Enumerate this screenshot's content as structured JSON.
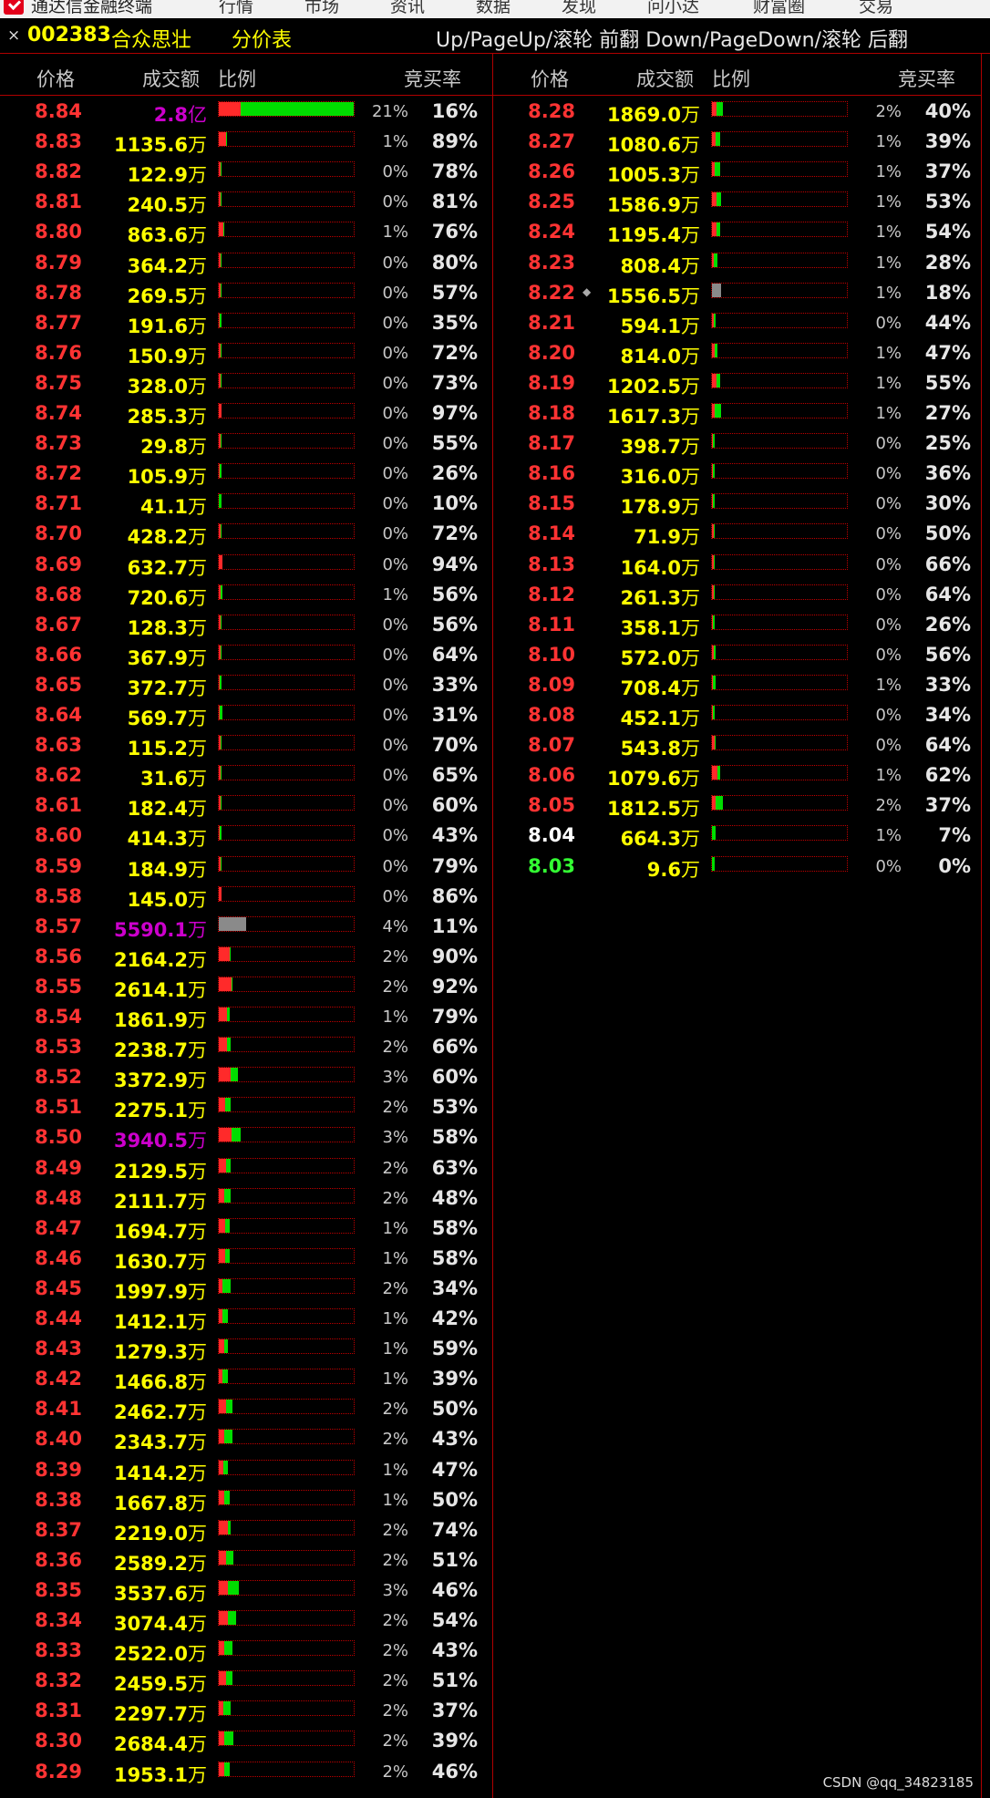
{
  "menubar": {
    "app_title": "通达信金融终端",
    "items": [
      "行情",
      "市场",
      "资讯",
      "数据",
      "发现",
      "问小达",
      "财富圈",
      "交易"
    ]
  },
  "titlebar": {
    "close_symbol": "×",
    "stock_code": "002383",
    "stock_name": "合众思壮",
    "table_name": "分价表",
    "hint": "Up/PageUp/滚轮 前翻 Down/PageDown/滚轮 后翻"
  },
  "headers": {
    "price": "价格",
    "volume": "成交额",
    "ratio": "比例",
    "bid_rate": "竞买率"
  },
  "colors": {
    "up": "#ff3333",
    "flat": "#ffffff",
    "down": "#33ff33",
    "volume_normal": "#ffff00",
    "volume_large": "#cc00cc",
    "bar_buy": "#ff2a2a",
    "bar_sell": "#00dd00",
    "divider": "#b00000"
  },
  "left_rows": [
    {
      "price": "8.84",
      "amount": "2.8",
      "unit": "亿",
      "pct": "21%",
      "rate": "16%",
      "big": true,
      "share": 1.0,
      "buy": 0.16
    },
    {
      "price": "8.83",
      "amount": "1135.6",
      "unit": "万",
      "pct": "1%",
      "rate": "89%",
      "share": 0.06,
      "buy": 0.89
    },
    {
      "price": "8.82",
      "amount": "122.9",
      "unit": "万",
      "pct": "0%",
      "rate": "78%",
      "share": 0.01,
      "buy": 0.78
    },
    {
      "price": "8.81",
      "amount": "240.5",
      "unit": "万",
      "pct": "0%",
      "rate": "81%",
      "share": 0.01,
      "buy": 0.81
    },
    {
      "price": "8.80",
      "amount": "863.6",
      "unit": "万",
      "pct": "1%",
      "rate": "76%",
      "share": 0.04,
      "buy": 0.76
    },
    {
      "price": "8.79",
      "amount": "364.2",
      "unit": "万",
      "pct": "0%",
      "rate": "80%",
      "share": 0.01,
      "buy": 0.8
    },
    {
      "price": "8.78",
      "amount": "269.5",
      "unit": "万",
      "pct": "0%",
      "rate": "57%",
      "share": 0.01,
      "buy": 0.57
    },
    {
      "price": "8.77",
      "amount": "191.6",
      "unit": "万",
      "pct": "0%",
      "rate": "35%",
      "share": 0.01,
      "buy": 0.35
    },
    {
      "price": "8.76",
      "amount": "150.9",
      "unit": "万",
      "pct": "0%",
      "rate": "72%",
      "share": 0.01,
      "buy": 0.72
    },
    {
      "price": "8.75",
      "amount": "328.0",
      "unit": "万",
      "pct": "0%",
      "rate": "73%",
      "share": 0.01,
      "buy": 0.73
    },
    {
      "price": "8.74",
      "amount": "285.3",
      "unit": "万",
      "pct": "0%",
      "rate": "97%",
      "share": 0.01,
      "buy": 0.97
    },
    {
      "price": "8.73",
      "amount": "29.8",
      "unit": "万",
      "pct": "0%",
      "rate": "55%",
      "share": 0.01,
      "buy": 0.55
    },
    {
      "price": "8.72",
      "amount": "105.9",
      "unit": "万",
      "pct": "0%",
      "rate": "26%",
      "share": 0.01,
      "buy": 0.26
    },
    {
      "price": "8.71",
      "amount": "41.1",
      "unit": "万",
      "pct": "0%",
      "rate": "10%",
      "share": 0.01,
      "buy": 0.1
    },
    {
      "price": "8.70",
      "amount": "428.2",
      "unit": "万",
      "pct": "0%",
      "rate": "72%",
      "share": 0.01,
      "buy": 0.72
    },
    {
      "price": "8.69",
      "amount": "632.7",
      "unit": "万",
      "pct": "0%",
      "rate": "94%",
      "share": 0.03,
      "buy": 0.94
    },
    {
      "price": "8.68",
      "amount": "720.6",
      "unit": "万",
      "pct": "1%",
      "rate": "56%",
      "share": 0.03,
      "buy": 0.56
    },
    {
      "price": "8.67",
      "amount": "128.3",
      "unit": "万",
      "pct": "0%",
      "rate": "56%",
      "share": 0.01,
      "buy": 0.56
    },
    {
      "price": "8.66",
      "amount": "367.9",
      "unit": "万",
      "pct": "0%",
      "rate": "64%",
      "share": 0.01,
      "buy": 0.64
    },
    {
      "price": "8.65",
      "amount": "372.7",
      "unit": "万",
      "pct": "0%",
      "rate": "33%",
      "share": 0.01,
      "buy": 0.33
    },
    {
      "price": "8.64",
      "amount": "569.7",
      "unit": "万",
      "pct": "0%",
      "rate": "31%",
      "share": 0.03,
      "buy": 0.31
    },
    {
      "price": "8.63",
      "amount": "115.2",
      "unit": "万",
      "pct": "0%",
      "rate": "70%",
      "share": 0.01,
      "buy": 0.7
    },
    {
      "price": "8.62",
      "amount": "31.6",
      "unit": "万",
      "pct": "0%",
      "rate": "65%",
      "share": 0.01,
      "buy": 0.65
    },
    {
      "price": "8.61",
      "amount": "182.4",
      "unit": "万",
      "pct": "0%",
      "rate": "60%",
      "share": 0.01,
      "buy": 0.6
    },
    {
      "price": "8.60",
      "amount": "414.3",
      "unit": "万",
      "pct": "0%",
      "rate": "43%",
      "share": 0.01,
      "buy": 0.43
    },
    {
      "price": "8.59",
      "amount": "184.9",
      "unit": "万",
      "pct": "0%",
      "rate": "79%",
      "share": 0.01,
      "buy": 0.79
    },
    {
      "price": "8.58",
      "amount": "145.0",
      "unit": "万",
      "pct": "0%",
      "rate": "86%",
      "share": 0.01,
      "buy": 0.86
    },
    {
      "price": "8.57",
      "amount": "5590.1",
      "unit": "万",
      "pct": "4%",
      "rate": "11%",
      "big": true,
      "gray": true,
      "share": 0.2,
      "buy": 0.11
    },
    {
      "price": "8.56",
      "amount": "2164.2",
      "unit": "万",
      "pct": "2%",
      "rate": "90%",
      "share": 0.09,
      "buy": 0.9
    },
    {
      "price": "8.55",
      "amount": "2614.1",
      "unit": "万",
      "pct": "2%",
      "rate": "92%",
      "share": 0.1,
      "buy": 0.92
    },
    {
      "price": "8.54",
      "amount": "1861.9",
      "unit": "万",
      "pct": "1%",
      "rate": "79%",
      "share": 0.08,
      "buy": 0.79
    },
    {
      "price": "8.53",
      "amount": "2238.7",
      "unit": "万",
      "pct": "2%",
      "rate": "66%",
      "share": 0.09,
      "buy": 0.66
    },
    {
      "price": "8.52",
      "amount": "3372.9",
      "unit": "万",
      "pct": "3%",
      "rate": "60%",
      "share": 0.14,
      "buy": 0.6
    },
    {
      "price": "8.51",
      "amount": "2275.1",
      "unit": "万",
      "pct": "2%",
      "rate": "53%",
      "share": 0.09,
      "buy": 0.53
    },
    {
      "price": "8.50",
      "amount": "3940.5",
      "unit": "万",
      "pct": "3%",
      "rate": "58%",
      "big": true,
      "share": 0.16,
      "buy": 0.58
    },
    {
      "price": "8.49",
      "amount": "2129.5",
      "unit": "万",
      "pct": "2%",
      "rate": "63%",
      "share": 0.09,
      "buy": 0.63
    },
    {
      "price": "8.48",
      "amount": "2111.7",
      "unit": "万",
      "pct": "2%",
      "rate": "48%",
      "share": 0.09,
      "buy": 0.48
    },
    {
      "price": "8.47",
      "amount": "1694.7",
      "unit": "万",
      "pct": "1%",
      "rate": "58%",
      "share": 0.08,
      "buy": 0.58
    },
    {
      "price": "8.46",
      "amount": "1630.7",
      "unit": "万",
      "pct": "1%",
      "rate": "58%",
      "share": 0.08,
      "buy": 0.58
    },
    {
      "price": "8.45",
      "amount": "1997.9",
      "unit": "万",
      "pct": "2%",
      "rate": "34%",
      "share": 0.09,
      "buy": 0.34
    },
    {
      "price": "8.44",
      "amount": "1412.1",
      "unit": "万",
      "pct": "1%",
      "rate": "42%",
      "share": 0.07,
      "buy": 0.42
    },
    {
      "price": "8.43",
      "amount": "1279.3",
      "unit": "万",
      "pct": "1%",
      "rate": "59%",
      "share": 0.07,
      "buy": 0.59
    },
    {
      "price": "8.42",
      "amount": "1466.8",
      "unit": "万",
      "pct": "1%",
      "rate": "39%",
      "share": 0.07,
      "buy": 0.39
    },
    {
      "price": "8.41",
      "amount": "2462.7",
      "unit": "万",
      "pct": "2%",
      "rate": "50%",
      "share": 0.1,
      "buy": 0.5
    },
    {
      "price": "8.40",
      "amount": "2343.7",
      "unit": "万",
      "pct": "2%",
      "rate": "43%",
      "share": 0.1,
      "buy": 0.43
    },
    {
      "price": "8.39",
      "amount": "1414.2",
      "unit": "万",
      "pct": "1%",
      "rate": "47%",
      "share": 0.07,
      "buy": 0.47
    },
    {
      "price": "8.38",
      "amount": "1667.8",
      "unit": "万",
      "pct": "1%",
      "rate": "50%",
      "share": 0.08,
      "buy": 0.5
    },
    {
      "price": "8.37",
      "amount": "2219.0",
      "unit": "万",
      "pct": "2%",
      "rate": "74%",
      "share": 0.09,
      "buy": 0.74
    },
    {
      "price": "8.36",
      "amount": "2589.2",
      "unit": "万",
      "pct": "2%",
      "rate": "51%",
      "share": 0.11,
      "buy": 0.51
    },
    {
      "price": "8.35",
      "amount": "3537.6",
      "unit": "万",
      "pct": "3%",
      "rate": "46%",
      "share": 0.15,
      "buy": 0.46
    },
    {
      "price": "8.34",
      "amount": "3074.4",
      "unit": "万",
      "pct": "2%",
      "rate": "54%",
      "share": 0.13,
      "buy": 0.54
    },
    {
      "price": "8.33",
      "amount": "2522.0",
      "unit": "万",
      "pct": "2%",
      "rate": "43%",
      "share": 0.1,
      "buy": 0.43
    },
    {
      "price": "8.32",
      "amount": "2459.5",
      "unit": "万",
      "pct": "2%",
      "rate": "51%",
      "share": 0.1,
      "buy": 0.51
    },
    {
      "price": "8.31",
      "amount": "2297.7",
      "unit": "万",
      "pct": "2%",
      "rate": "37%",
      "share": 0.09,
      "buy": 0.37
    },
    {
      "price": "8.30",
      "amount": "2684.4",
      "unit": "万",
      "pct": "2%",
      "rate": "39%",
      "share": 0.11,
      "buy": 0.39
    },
    {
      "price": "8.29",
      "amount": "1953.1",
      "unit": "万",
      "pct": "2%",
      "rate": "46%",
      "share": 0.08,
      "buy": 0.46
    }
  ],
  "right_rows": [
    {
      "price": "8.28",
      "amount": "1869.0",
      "unit": "万",
      "pct": "2%",
      "rate": "40%",
      "share": 0.08,
      "buy": 0.4
    },
    {
      "price": "8.27",
      "amount": "1080.6",
      "unit": "万",
      "pct": "1%",
      "rate": "39%",
      "share": 0.06,
      "buy": 0.39
    },
    {
      "price": "8.26",
      "amount": "1005.3",
      "unit": "万",
      "pct": "1%",
      "rate": "37%",
      "share": 0.06,
      "buy": 0.37
    },
    {
      "price": "8.25",
      "amount": "1586.9",
      "unit": "万",
      "pct": "1%",
      "rate": "53%",
      "share": 0.07,
      "buy": 0.53
    },
    {
      "price": "8.24",
      "amount": "1195.4",
      "unit": "万",
      "pct": "1%",
      "rate": "54%",
      "share": 0.06,
      "buy": 0.54
    },
    {
      "price": "8.23",
      "amount": "808.4",
      "unit": "万",
      "pct": "1%",
      "rate": "28%",
      "share": 0.04,
      "buy": 0.28
    },
    {
      "price": "8.22",
      "amount": "1556.5",
      "unit": "万",
      "pct": "1%",
      "rate": "18%",
      "mark": "◆",
      "gray": true,
      "share": 0.07,
      "buy": 0.18
    },
    {
      "price": "8.21",
      "amount": "594.1",
      "unit": "万",
      "pct": "0%",
      "rate": "44%",
      "share": 0.03,
      "buy": 0.44
    },
    {
      "price": "8.20",
      "amount": "814.0",
      "unit": "万",
      "pct": "1%",
      "rate": "47%",
      "share": 0.04,
      "buy": 0.47
    },
    {
      "price": "8.19",
      "amount": "1202.5",
      "unit": "万",
      "pct": "1%",
      "rate": "55%",
      "share": 0.06,
      "buy": 0.55
    },
    {
      "price": "8.18",
      "amount": "1617.3",
      "unit": "万",
      "pct": "1%",
      "rate": "27%",
      "share": 0.07,
      "buy": 0.27
    },
    {
      "price": "8.17",
      "amount": "398.7",
      "unit": "万",
      "pct": "0%",
      "rate": "25%",
      "share": 0.01,
      "buy": 0.25
    },
    {
      "price": "8.16",
      "amount": "316.0",
      "unit": "万",
      "pct": "0%",
      "rate": "36%",
      "share": 0.01,
      "buy": 0.36
    },
    {
      "price": "8.15",
      "amount": "178.9",
      "unit": "万",
      "pct": "0%",
      "rate": "30%",
      "share": 0.01,
      "buy": 0.3
    },
    {
      "price": "8.14",
      "amount": "71.9",
      "unit": "万",
      "pct": "0%",
      "rate": "50%",
      "share": 0.01,
      "buy": 0.5
    },
    {
      "price": "8.13",
      "amount": "164.0",
      "unit": "万",
      "pct": "0%",
      "rate": "66%",
      "share": 0.01,
      "buy": 0.66
    },
    {
      "price": "8.12",
      "amount": "261.3",
      "unit": "万",
      "pct": "0%",
      "rate": "64%",
      "share": 0.01,
      "buy": 0.64
    },
    {
      "price": "8.11",
      "amount": "358.1",
      "unit": "万",
      "pct": "0%",
      "rate": "26%",
      "share": 0.01,
      "buy": 0.26
    },
    {
      "price": "8.10",
      "amount": "572.0",
      "unit": "万",
      "pct": "0%",
      "rate": "56%",
      "share": 0.03,
      "buy": 0.56
    },
    {
      "price": "8.09",
      "amount": "708.4",
      "unit": "万",
      "pct": "1%",
      "rate": "33%",
      "share": 0.03,
      "buy": 0.33
    },
    {
      "price": "8.08",
      "amount": "452.1",
      "unit": "万",
      "pct": "0%",
      "rate": "34%",
      "share": 0.01,
      "buy": 0.34
    },
    {
      "price": "8.07",
      "amount": "543.8",
      "unit": "万",
      "pct": "0%",
      "rate": "64%",
      "share": 0.03,
      "buy": 0.64
    },
    {
      "price": "8.06",
      "amount": "1079.6",
      "unit": "万",
      "pct": "1%",
      "rate": "62%",
      "share": 0.06,
      "buy": 0.62
    },
    {
      "price": "8.05",
      "amount": "1812.5",
      "unit": "万",
      "pct": "2%",
      "rate": "37%",
      "share": 0.08,
      "buy": 0.37
    },
    {
      "price": "8.04",
      "amount": "664.3",
      "unit": "万",
      "pct": "1%",
      "rate": "7%",
      "level": "flat",
      "share": 0.03,
      "buy": 0.07
    },
    {
      "price": "8.03",
      "amount": "9.6",
      "unit": "万",
      "pct": "0%",
      "rate": "0%",
      "level": "down",
      "share": 0.01,
      "buy": 0.0
    }
  ],
  "watermark": "CSDN @qq_34823185"
}
